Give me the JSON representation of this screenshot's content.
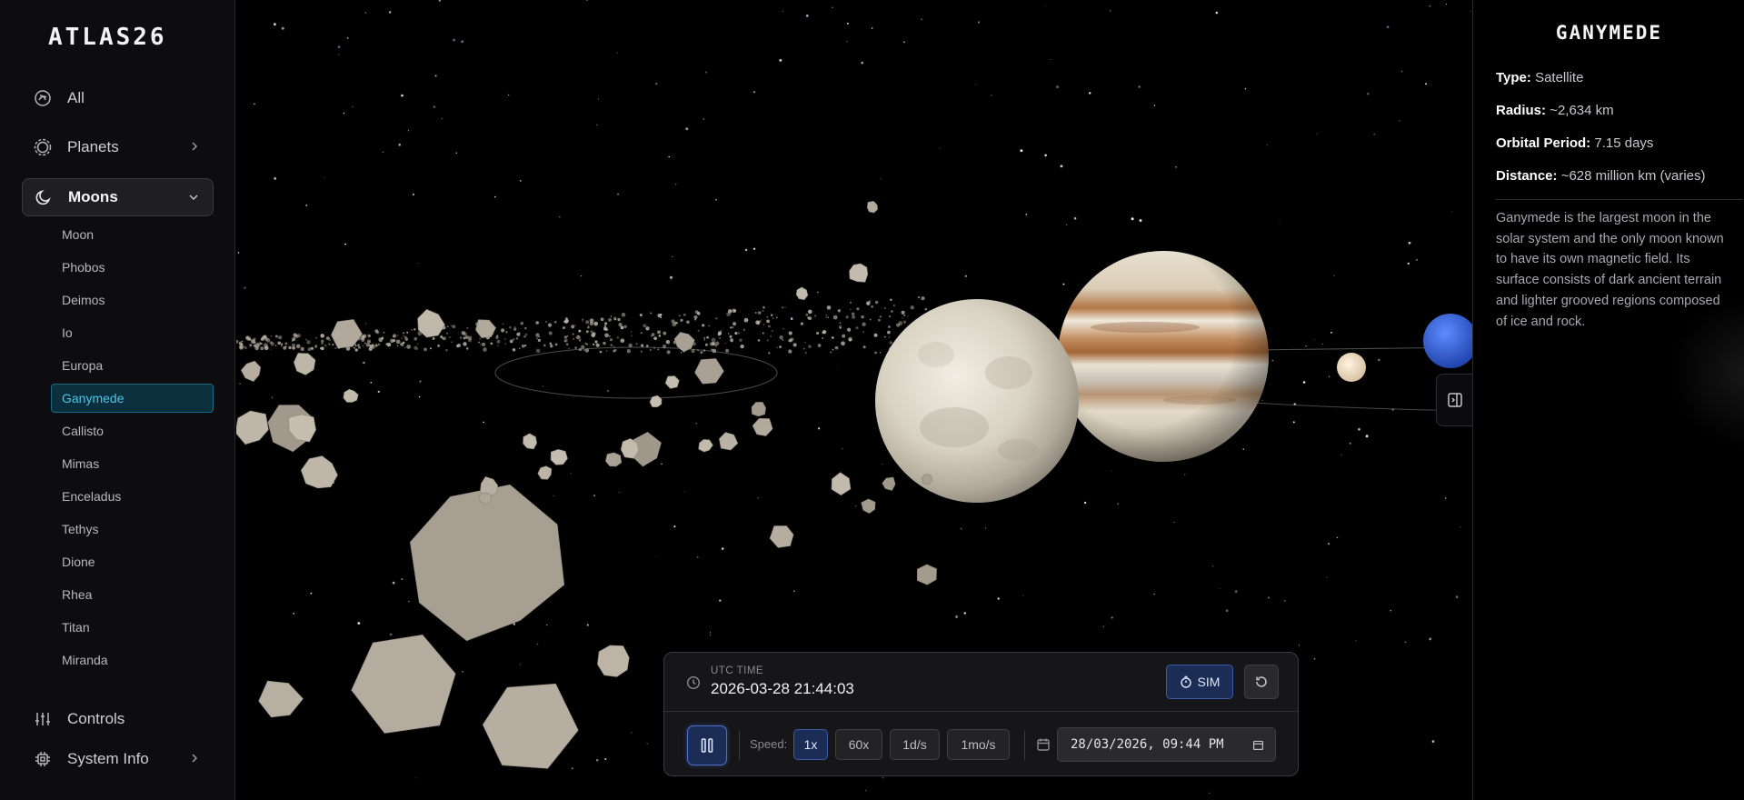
{
  "app": {
    "logo": "ATLAS26"
  },
  "sidebar": {
    "nav": [
      {
        "label": "All",
        "icon": "orbit-icon"
      },
      {
        "label": "Planets",
        "icon": "planet-icon",
        "chevron": "chevron-right-icon"
      },
      {
        "label": "Moons",
        "icon": "moon-icon",
        "chevron": "chevron-down-icon",
        "expanded": true
      }
    ],
    "moons": [
      "Moon",
      "Phobos",
      "Deimos",
      "Io",
      "Europa",
      "Ganymede",
      "Callisto",
      "Mimas",
      "Enceladus",
      "Tethys",
      "Dione",
      "Rhea",
      "Titan",
      "Miranda"
    ],
    "selected_moon": "Ganymede",
    "bottom": [
      {
        "label": "Controls",
        "icon": "sliders-icon"
      },
      {
        "label": "System Info",
        "icon": "chip-icon",
        "chevron": "chevron-right-icon"
      }
    ]
  },
  "time_panel": {
    "utc_label": "UTC TIME",
    "utc_value": "2026-03-28 21:44:03",
    "sim_label": "SIM",
    "speed_label": "Speed:",
    "speeds": [
      "1x",
      "60x",
      "1d/s",
      "1mo/s"
    ],
    "active_speed": "1x",
    "date_value": "28/03/2026, 09:44 PM"
  },
  "info": {
    "title": "GANYMEDE",
    "rows": [
      {
        "key": "Type:",
        "value": "Satellite"
      },
      {
        "key": "Radius:",
        "value": "~2,634 km"
      },
      {
        "key": "Orbital Period:",
        "value": "7.15 days"
      },
      {
        "key": "Distance:",
        "value": "~628 million km (varies)"
      }
    ],
    "description": "Ganymede is the largest moon in the solar system and the only moon known to have its own magnetic field. Its surface consists of dark ancient terrain and lighter grooved regions composed of ice and rock."
  },
  "colors": {
    "accent": "#4fc4e8",
    "sim_blue": "#1b2c55",
    "panel_bg": "#161618"
  }
}
